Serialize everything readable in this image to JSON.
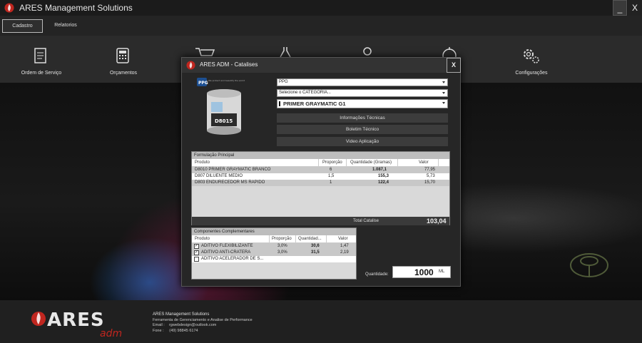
{
  "app": {
    "title": "ARES Management Solutions",
    "minimize_label": "_",
    "close_label": "X"
  },
  "menu": {
    "tabs": [
      {
        "label": "Cadastro"
      },
      {
        "label": "Relatorios"
      }
    ]
  },
  "toolbar": {
    "items": [
      {
        "label": "Ordem de Serviço",
        "icon": "document-icon"
      },
      {
        "label": "Orçamentos",
        "icon": "calculator-icon"
      },
      {
        "label": "",
        "icon": "cart-icon"
      },
      {
        "label": "",
        "icon": "flask-icon"
      },
      {
        "label": "",
        "icon": "user-icon"
      },
      {
        "label": "",
        "icon": "stopwatch-icon"
      },
      {
        "label": "Configurações",
        "icon": "gears-icon"
      }
    ]
  },
  "dialog": {
    "title": "ARES ADM - Catalises",
    "close_label": "X",
    "product_code": "D8015",
    "brand_tagline": "We protect and beautify the world",
    "brand_select": "PPG",
    "category_select": "Selecione o CATEGORIA...",
    "product_select": "PRIMER GRAYMATIC G1",
    "buttons": [
      "Informações Técnicas",
      "Boletim Técnico",
      "Video Aplicação"
    ],
    "main_formula": {
      "title": "Formulação Principal",
      "columns": [
        "Produto",
        "Proporção",
        "Quantidade (Gramas)",
        "Valor"
      ],
      "rows": [
        {
          "produto": "D8010 PRIMER GRAYMATIC BRANCO",
          "proporcao": "6",
          "quantidade": "1.087,1",
          "valor": "77,95"
        },
        {
          "produto": "D807 DILUENTE MEDIO",
          "proporcao": "1,5",
          "quantidade": "155,3",
          "valor": "5,73"
        },
        {
          "produto": "D803 ENDURECEDOR MS RAPIDO",
          "proporcao": "1",
          "quantidade": "122,4",
          "valor": "15,70"
        }
      ],
      "total_label": "Total Catalise",
      "total_value": "103,04"
    },
    "complementary": {
      "title": "Componentes Complementares",
      "columns": [
        "Produto",
        "Proporção",
        "Quantidad...",
        "Valor"
      ],
      "rows": [
        {
          "checked": true,
          "produto": "ADITIVO FLEXIBILIZANTE",
          "proporcao": "3,0%",
          "quantidade": "30,6",
          "valor": "1,47"
        },
        {
          "checked": true,
          "produto": "ADITIVO ANTI-CRATERA",
          "proporcao": "3,0%",
          "quantidade": "31,5",
          "valor": "2,19"
        },
        {
          "checked": false,
          "produto": "ADITIVO ACELERADOR DE S...",
          "proporcao": "",
          "quantidade": "",
          "valor": ""
        }
      ]
    },
    "quantity": {
      "label": "Quantidade:",
      "value": "1000",
      "unit": "ML"
    }
  },
  "footer": {
    "brand": "ARES",
    "brand_sub": "adm",
    "title": "ARES Management Solutions",
    "subtitle": "Ferramenta de Gerenciamento e Analise de Performance",
    "email_label": "Email :",
    "email": "rgwebdesign@outlook.com",
    "phone_label": "Fone :",
    "phone": "(49) 98845 6174"
  },
  "colors": {
    "accent_red": "#c0261f",
    "background": "#1e1e1e",
    "panel": "#d9d9d9"
  }
}
